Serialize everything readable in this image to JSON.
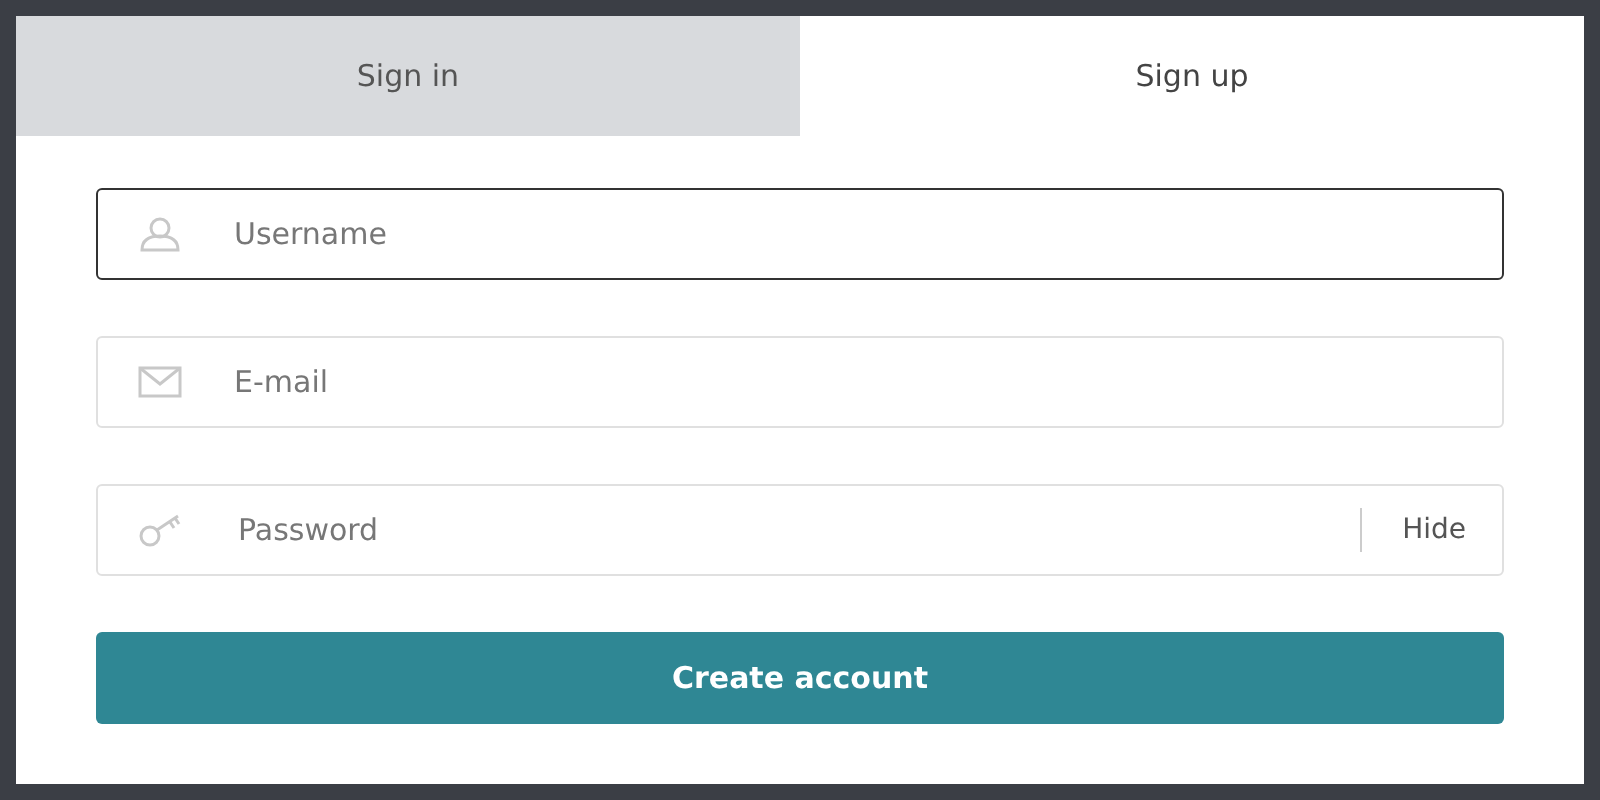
{
  "tabs": [
    {
      "label": "Sign in",
      "selected": false
    },
    {
      "label": "Sign up",
      "selected": true
    }
  ],
  "fields": [
    {
      "kind": "user",
      "placeholder": "Username",
      "focused": true
    },
    {
      "kind": "mail",
      "placeholder": "E-mail",
      "focused": false
    },
    {
      "kind": "key",
      "placeholder": "Password",
      "focused": false,
      "toggle": "Hide"
    }
  ],
  "submit": "Create account"
}
